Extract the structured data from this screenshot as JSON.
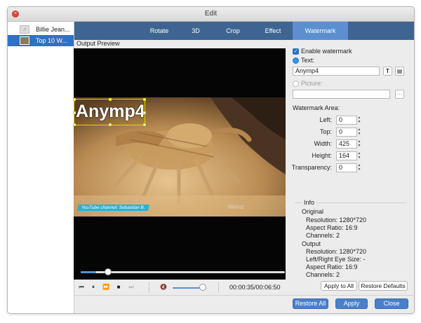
{
  "window": {
    "title": "Edit"
  },
  "files": [
    {
      "name": "Billie Jean...",
      "selected": false
    },
    {
      "name": "Top 10 W...",
      "selected": true
    }
  ],
  "tabs": [
    "Rotate",
    "3D",
    "Crop",
    "Effect",
    "Watermark"
  ],
  "active_tab": "Watermark",
  "preview": {
    "label": "Output Preview",
    "watermark_text": "Anymp4",
    "channel_banner": "YouTube channel: Sebastian B.",
    "faint_brand": "Weird"
  },
  "player": {
    "progress_fraction": 0.08,
    "volume_fraction": 0.8,
    "timecode": "00:00:35/00:06:50"
  },
  "watermark": {
    "enable_label": "Enable watermark",
    "enabled": true,
    "text_label": "Text:",
    "text_value": "Anymp4",
    "picture_label": "Picture:",
    "picture_value": "",
    "browse_label": "···",
    "area_label": "Watermark Area:",
    "left_label": "Left:",
    "left": "0",
    "top_label": "Top:",
    "top": "0",
    "width_label": "Width:",
    "width": "425",
    "height_label": "Height:",
    "height": "164",
    "transparency_label": "Transparency:",
    "transparency": "0"
  },
  "info": {
    "title": "Info",
    "original_title": "Original",
    "original_resolution": "Resolution: 1280*720",
    "original_aspect": "Aspect Ratio: 16:9",
    "original_channels": "Channels: 2",
    "output_title": "Output",
    "output_resolution": "Resolution: 1280*720",
    "output_eye": "Left/Right Eye Size: -",
    "output_aspect": "Aspect Ratio: 16:9",
    "output_channels": "Channels: 2"
  },
  "buttons": {
    "apply_to_all": "Apply to All",
    "restore_defaults": "Restore Defaults",
    "restore_all": "Restore All",
    "apply": "Apply",
    "close": "Close"
  },
  "colors": {
    "accent": "#2f71c7",
    "tabbar": "#3e6491",
    "tab_active": "#5b8fd0",
    "watermark_box": "#e6d400",
    "banner": "#2bb0d6",
    "mute": "#d8433a"
  }
}
